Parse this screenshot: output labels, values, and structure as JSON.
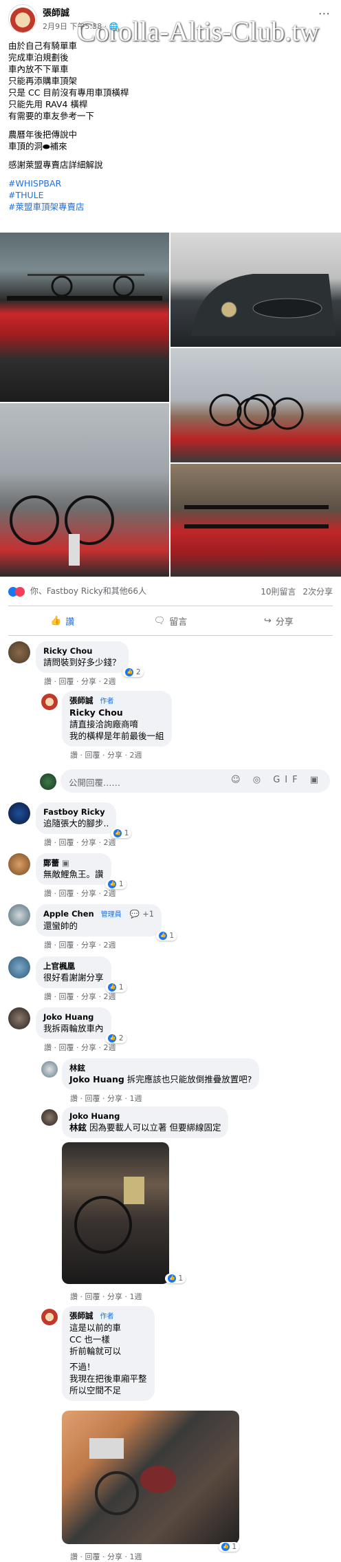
{
  "watermark": "Corolla-Altis-Club.tw",
  "post": {
    "author": "張師誠",
    "meta": "2月9日 下午5:38 · 🌐",
    "more": "···",
    "lines": [
      "由於自己有騎單車",
      "完成車泊規劃後",
      "車內放不下單車",
      "只能再添購車頂架",
      "只是 CC 目前沒有專用車頂橫桿",
      "只能先用 RAV4 橫桿",
      "有需要的車友參考一下"
    ],
    "lines2": [
      "農曆年後把傳說中",
      "車頂的洞⬬補來"
    ],
    "line3": "感謝萊盟專賣店詳細解說",
    "tags": [
      "#WHISPBAR",
      "#THULE",
      "#萊盟車頂架專賣店"
    ]
  },
  "stats": {
    "reactions": "你、Fastboy Ricky和其他66人",
    "comments": "10則留言",
    "shares": "2次分享"
  },
  "actions": {
    "like": "讚",
    "comment": "留言",
    "share": "分享"
  },
  "comments": [
    {
      "name": "Ricky Chou",
      "text": [
        "請問裝到好多少錢？"
      ],
      "likes": "2",
      "meta": "讚 · 回覆 · 分享 · 2週"
    },
    {
      "name": "張師誠",
      "badge": "作者",
      "text_bold": "Ricky Chou",
      "text": [
        "請直接洽詢廠商唷",
        "我的橫桿是年前最後一組"
      ],
      "meta": "讚 · 回覆 · 分享 · 2週"
    },
    {
      "name": "Fastboy Ricky",
      "text": [
        "追隨張大的腳步.."
      ],
      "likes": "1",
      "meta": "讚 · 回覆 · 分享 · 2週"
    },
    {
      "name": "鄭蕾",
      "text": [
        "無敵鯉魚王。讚"
      ],
      "likes": "1",
      "meta": "讚 · 回覆 · 分享 · 2週"
    },
    {
      "name": "Apple Chen",
      "badge": "管理員",
      "extra": "+1",
      "text": [
        "還蠻帥的"
      ],
      "likes": "1",
      "meta": "讚 · 回覆 · 分享 · 2週"
    },
    {
      "name": "上官楓凰",
      "text": [
        "很好看謝謝分享"
      ],
      "likes": "1",
      "meta": "讚 · 回覆 · 分享 · 2週"
    },
    {
      "name": "Joko Huang",
      "text": [
        "我拆兩輪放車內"
      ],
      "likes": "2",
      "meta": "讚 · 回覆 · 分享 · 2週"
    },
    {
      "name": "林鉉",
      "text_bold": "Joko Huang",
      "text": [
        "拆完應該也只能放倒推疊放置吧?"
      ],
      "meta": "讚 · 回覆 · 分享 · 1週"
    },
    {
      "name": "Joko Huang",
      "text_bold": "林鉉",
      "text": [
        "因為要載人可以立著 但要綁線固定"
      ],
      "likes": "1",
      "meta": "讚 · 回覆 · 分享 · 1週"
    },
    {
      "name": "張師誠",
      "badge": "作者",
      "text": [
        "這是以前的車",
        "CC 也一樣",
        "折前輪就可以",
        "不過！",
        "我現在把後車廂平整",
        "所以空間不足"
      ],
      "likes": "1",
      "meta": "讚 · 回覆 · 分享 · 1週"
    }
  ],
  "reply_box": {
    "placeholder": "公開回覆……",
    "icons": "☺ ◎ GIF ▣"
  }
}
